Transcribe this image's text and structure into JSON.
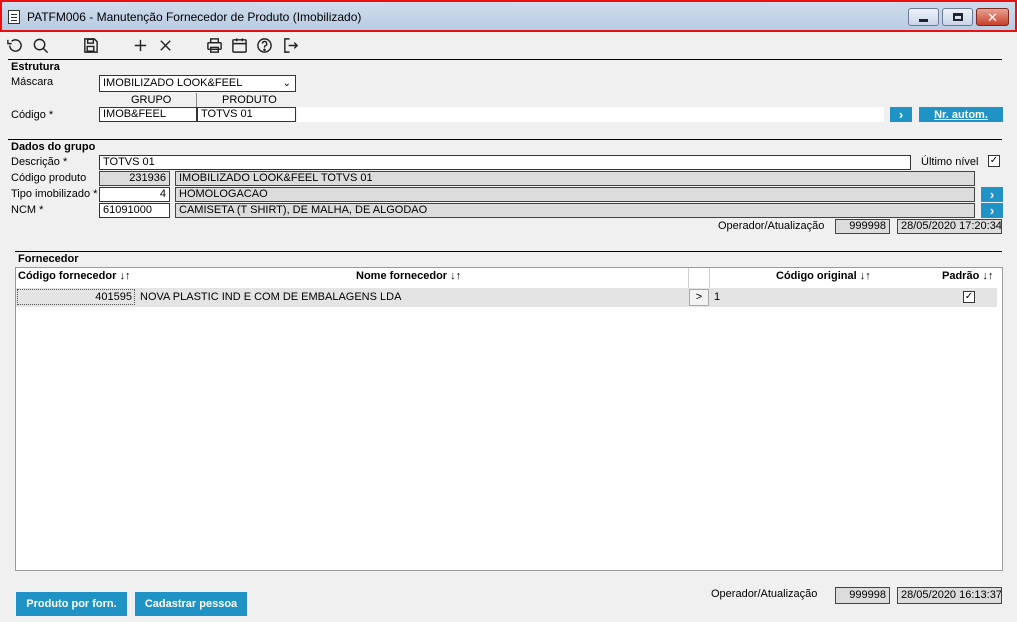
{
  "window": {
    "title": "PATFM006 - Manutenção Fornecedor de Produto (Imobilizado)"
  },
  "estrutura": {
    "title": "Estrutura",
    "mascara_label": "Máscara",
    "mascara_value": "IMOBILIZADO LOOK&FEEL",
    "grupo_header": "GRUPO",
    "produto_header": "PRODUTO",
    "codigo_label": "Código *",
    "grupo_value": "IMOB&FEEL",
    "produto_value": "TOTVS 01",
    "nr_autom_label": "Nr. autom."
  },
  "dados_grupo": {
    "title": "Dados do grupo",
    "descricao_label": "Descrição *",
    "descricao_value": "TOTVS 01",
    "ultimo_nivel_label": "Último nível",
    "ultimo_nivel_checked": true,
    "codigo_produto_label": "Código produto",
    "codigo_produto_value": "231936",
    "codigo_produto_desc": "IMOBILIZADO LOOK&FEEL TOTVS 01",
    "tipo_imobilizado_label": "Tipo imobilizado *",
    "tipo_imobilizado_value": "4",
    "tipo_imobilizado_desc": "HOMOLOGACAO",
    "ncm_label": "NCM *",
    "ncm_value": "61091000",
    "ncm_desc": "CAMISETA (T SHIRT), DE MALHA, DE ALGODAO",
    "operador_label": "Operador/Atualização",
    "operador_value": "999998",
    "atualizacao_value": "28/05/2020 17:20:34"
  },
  "fornecedor": {
    "title": "Fornecedor",
    "columns": [
      "Código fornecedor ↓↑",
      "Nome fornecedor ↓↑",
      "Código original ↓↑",
      "Padrão ↓↑"
    ],
    "rows": [
      {
        "codigo": "401595",
        "nome": "NOVA PLASTIC IND E COM DE EMBALAGENS LDA",
        "action": ">",
        "codigo_original": "1",
        "padrao": true
      }
    ]
  },
  "footer": {
    "produto_por_forn_label": "Produto por forn.",
    "cadastrar_pessoa_label": "Cadastrar pessoa",
    "operador_label": "Operador/Atualização",
    "operador_value": "999998",
    "atualizacao_value": "28/05/2020 16:13:37"
  },
  "icons": [
    "undo-icon",
    "search-icon",
    "save-icon",
    "add-icon",
    "delete-icon",
    "print-icon",
    "calendar-icon",
    "help-icon",
    "exit-icon"
  ],
  "colors": {
    "accent": "#1f93c6",
    "titlebar_border": "#e81010",
    "readonly_bg": "#dcdcdc"
  }
}
